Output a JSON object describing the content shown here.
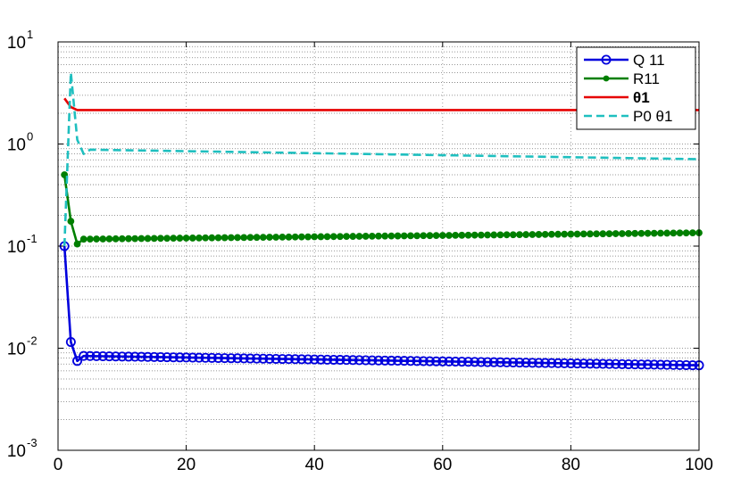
{
  "chart_data": {
    "type": "line",
    "title": "",
    "xlabel": "",
    "ylabel": "",
    "xlim": [
      0,
      100
    ],
    "ylim": [
      0.001,
      10
    ],
    "yscale": "log",
    "grid": true,
    "legend_position": "top-right",
    "x_ticks": [
      "0",
      "20",
      "40",
      "60",
      "80",
      "100"
    ],
    "x_tick_values": [
      0,
      20,
      40,
      60,
      80,
      100
    ],
    "y_ticks": [
      {
        "base": "10",
        "exp": "-3",
        "value": 0.001
      },
      {
        "base": "10",
        "exp": "-2",
        "value": 0.01
      },
      {
        "base": "10",
        "exp": "-1",
        "value": 0.1
      },
      {
        "base": "10",
        "exp": "0",
        "value": 1
      },
      {
        "base": "10",
        "exp": "1",
        "value": 10
      }
    ],
    "series": [
      {
        "name": "Q  11",
        "color": "#0000dd",
        "style": "solid",
        "marker": "circle-open",
        "x": [
          1,
          2,
          3,
          4,
          100
        ],
        "y": [
          0.1,
          0.0115,
          0.0075,
          0.0084,
          0.0068
        ]
      },
      {
        "name": "R11",
        "color": "#007f00",
        "style": "solid",
        "marker": "dot",
        "x": [
          1,
          2,
          3,
          4,
          100
        ],
        "y": [
          0.5,
          0.175,
          0.105,
          0.117,
          0.135
        ]
      },
      {
        "name": "θ1",
        "color": "#e60000",
        "style": "solid",
        "marker": "none",
        "x": [
          1,
          2,
          3,
          100
        ],
        "y": [
          2.8,
          2.3,
          2.15,
          2.15
        ]
      },
      {
        "name": "P0 θ1",
        "color": "#1fbfbf",
        "style": "dashed",
        "marker": "none",
        "x": [
          1,
          2,
          3,
          4,
          5,
          100
        ],
        "y": [
          0.1,
          5.0,
          1.1,
          0.8,
          0.88,
          0.71
        ]
      }
    ]
  }
}
